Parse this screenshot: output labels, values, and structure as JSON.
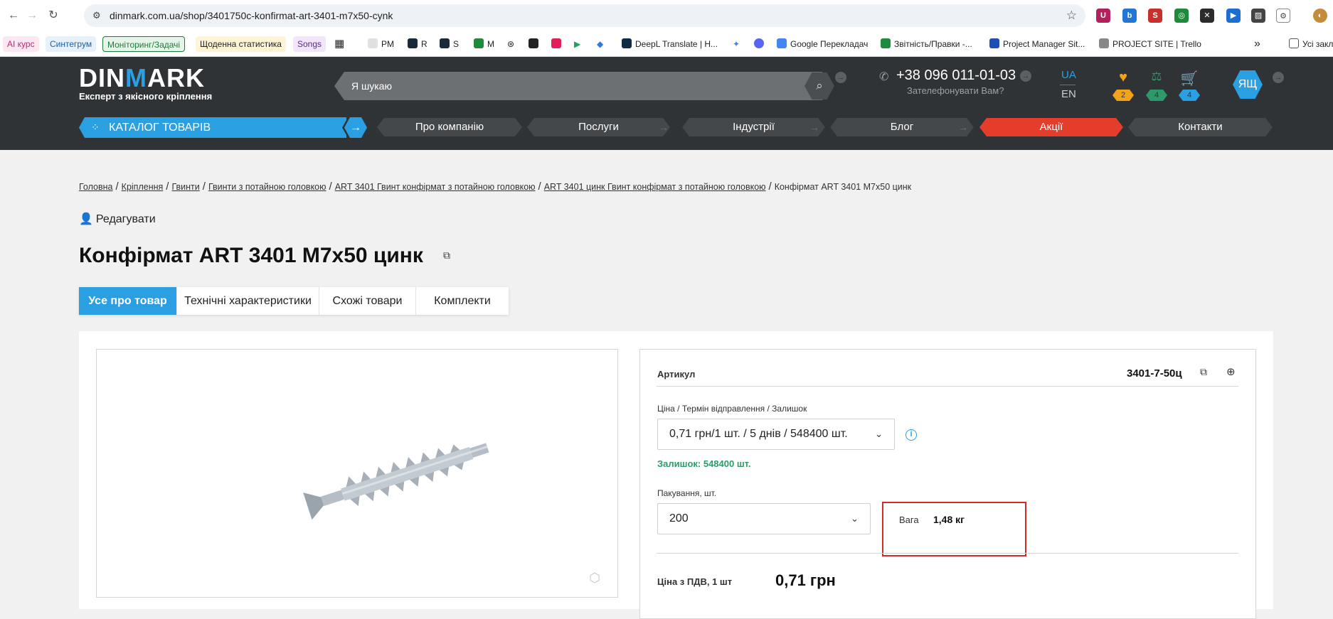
{
  "browser": {
    "url": "dinmark.com.ua/shop/3401750c-konfirmat-art-3401-m7x50-cynk",
    "back_icon": "←",
    "forward_icon": "→",
    "reload_icon": "↻",
    "star_icon": "☆",
    "extensions": [
      "U",
      "b",
      "S",
      "◎",
      "✕",
      "▶",
      "▨",
      "⚙",
      "◐"
    ],
    "bookmarks": [
      {
        "label": "AI курс",
        "bg": "#fde7f1",
        "color": "#c0267a"
      },
      {
        "label": "Синтегрум",
        "bg": "#e6f1fb",
        "color": "#1f5fa8"
      },
      {
        "label": "Моніторинг/Задачі",
        "bg": "#e5f5ea",
        "color": "#1f7a3c"
      },
      {
        "label": "Щоденна статистика",
        "bg": "#fff4d6",
        "color": "#222"
      },
      {
        "label": "Songs",
        "bg": "#f1e6fb",
        "color": "#5b2a8a"
      },
      {
        "label": "PM"
      },
      {
        "label": "R"
      },
      {
        "label": "S"
      },
      {
        "label": "M"
      },
      {
        "label": "DeepL Translate | H..."
      },
      {
        "label": "Google Перекладач"
      },
      {
        "label": "Звітність/Правки -..."
      },
      {
        "label": "Project Manager Sit..."
      },
      {
        "label": "PROJECT SITE | Trello"
      },
      {
        "label": "»"
      },
      {
        "label": "Усі заклад"
      }
    ]
  },
  "header": {
    "logo_part1": "DIN",
    "logo_part2": "M",
    "logo_part3": "ARK",
    "logo_sub": "Експерт з якісного кріплення",
    "search_placeholder": "Я шукаю",
    "phone": "+38 096 011-01-03",
    "callback": "Зателефонувати Вам?",
    "lang_active": "UA",
    "lang_other": "EN",
    "favorites_count": "2",
    "compare_count": "4",
    "cart_count": "4",
    "avatar_initials": "ЯЩ",
    "catalog_label": "КАТАЛОГ ТОВАРІВ",
    "menu": [
      "Про компанію",
      "Послуги",
      "Індустрії",
      "Блог",
      "Акції",
      "Контакти"
    ]
  },
  "breadcrumb": [
    "Головна",
    "Кріплення",
    "Гвинти",
    "Гвинти з потайною головкою",
    "ART 3401 Гвинт конфірмат з потайною головкою",
    "ART 3401 цинк Гвинт конфірмат з потайною головкою",
    "Конфірмат ART 3401 M7x50 цинк"
  ],
  "edit_label": "Редагувати",
  "product": {
    "title": "Конфірмат ART 3401 M7x50 цинк",
    "tabs": [
      "Усе про товар",
      "Технічні характеристики",
      "Схожі товари",
      "Комплекти"
    ],
    "sku_label": "Артикул",
    "sku": "3401-7-50ц",
    "price_term_label": "Ціна / Термін відправлення / Залишок",
    "price_term_value": "0,71 грн/1 шт. / 5 днів / 548400 шт.",
    "stock": "Залишок: 548400 шт.",
    "packing_label": "Пакування, шт.",
    "packing_value": "200",
    "weight_label": "Вага",
    "weight_value": "1,48 кг",
    "price_label": "Ціна з ПДВ, 1 шт",
    "price_value": "0,71 грн"
  },
  "colors": {
    "accent": "#2aa0e3",
    "header_bg": "#2f3336",
    "promo": "#e53d2c",
    "stock_green": "#2c9b69",
    "highlight_red": "#d32a2a"
  }
}
